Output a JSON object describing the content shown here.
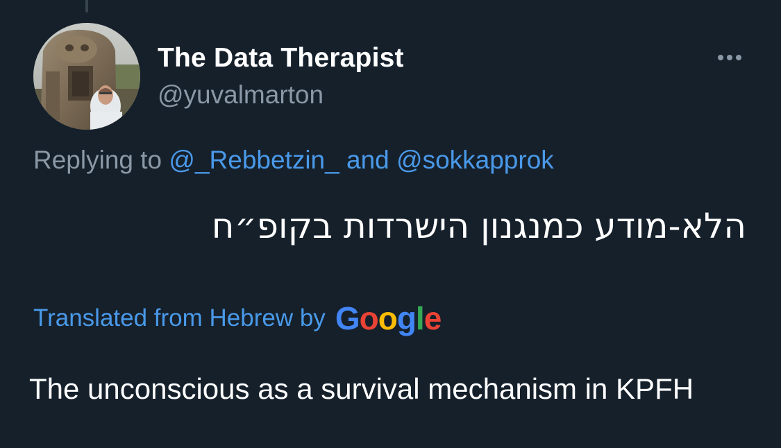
{
  "tweet": {
    "author_name": "The Data Therapist",
    "author_handle": "@yuvalmarton",
    "more_icon": "ellipsis-icon",
    "replying_prefix": "Replying to ",
    "replying_mention_1": "@_Rebbetzin_",
    "replying_conjunction": " and ",
    "replying_mention_2": "@sokkapprok",
    "text_hebrew": "הלא-מודע כמנגנון הישרדות בקופ״ח",
    "translated_label": "Translated from Hebrew by",
    "google_logo": {
      "letters": [
        "G",
        "o",
        "o",
        "g",
        "l",
        "e"
      ],
      "colors": [
        "#4285f4",
        "#ea4335",
        "#fbbc05",
        "#4285f4",
        "#34a853",
        "#ea4335"
      ]
    },
    "text_translation": "The unconscious as a survival mechanism in KPFH"
  },
  "colors": {
    "background": "#15202b",
    "link": "#4a99e9",
    "secondary_text": "#8b98a5"
  }
}
